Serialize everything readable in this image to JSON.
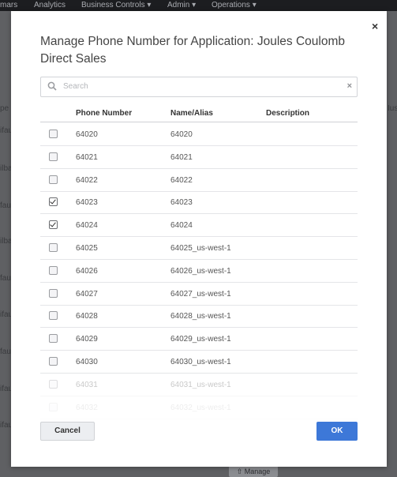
{
  "nav": {
    "items": [
      "mars",
      "Analytics",
      "Business Controls",
      "Admin",
      "Operations"
    ]
  },
  "background": {
    "fragments": [
      "pe",
      "ifau",
      "ilba",
      "fau",
      "ilba",
      "fau",
      "ifau",
      "fau",
      "ifau",
      "ifau"
    ],
    "right_fragment": "Ius",
    "button_label": "Manage"
  },
  "modal": {
    "title": "Manage Phone Number for Application: Joules Coulomb Direct Sales",
    "close_label": "×",
    "search": {
      "placeholder": "Search",
      "clear_label": "×"
    },
    "columns": {
      "phone": "Phone Number",
      "alias": "Name/Alias",
      "description": "Description"
    },
    "rows": [
      {
        "number": "64020",
        "alias": "64020",
        "checked": false
      },
      {
        "number": "64021",
        "alias": "64021",
        "checked": false
      },
      {
        "number": "64022",
        "alias": "64022",
        "checked": false
      },
      {
        "number": "64023",
        "alias": "64023",
        "checked": true
      },
      {
        "number": "64024",
        "alias": "64024",
        "checked": true
      },
      {
        "number": "64025",
        "alias": "64025_us-west-1",
        "checked": false
      },
      {
        "number": "64026",
        "alias": "64026_us-west-1",
        "checked": false
      },
      {
        "number": "64027",
        "alias": "64027_us-west-1",
        "checked": false
      },
      {
        "number": "64028",
        "alias": "64028_us-west-1",
        "checked": false
      },
      {
        "number": "64029",
        "alias": "64029_us-west-1",
        "checked": false
      },
      {
        "number": "64030",
        "alias": "64030_us-west-1",
        "checked": false
      },
      {
        "number": "64031",
        "alias": "64031_us-west-1",
        "checked": false
      },
      {
        "number": "64032",
        "alias": "64032_us-west-1",
        "checked": false
      }
    ],
    "cancel_label": "Cancel",
    "ok_label": "OK"
  }
}
